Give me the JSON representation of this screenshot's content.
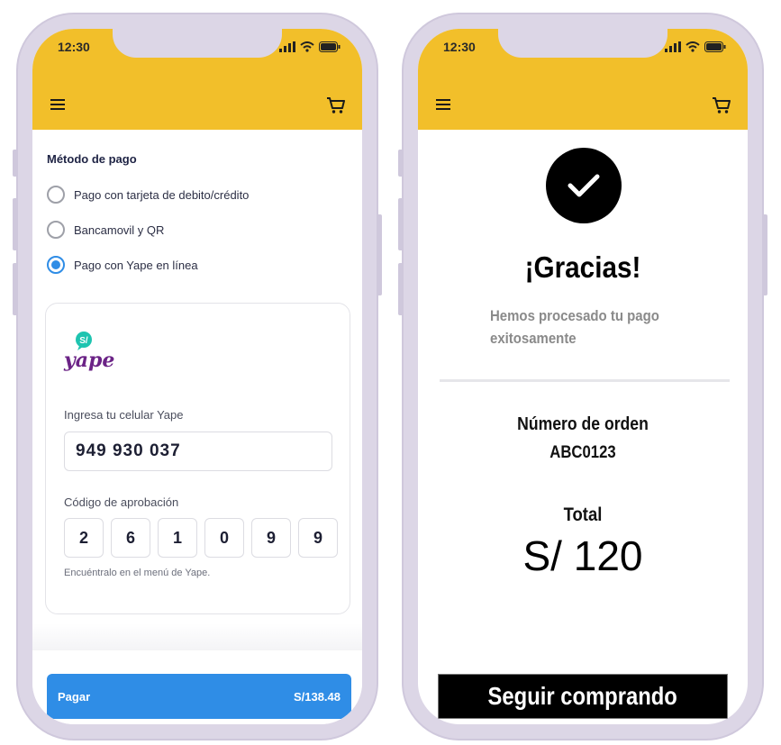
{
  "colors": {
    "header": "#f2bf2a",
    "accent_blue": "#2f8de6",
    "phone_frame": "#dcd6e6",
    "yape_purple": "#6b2386",
    "yape_teal": "#1ec4b0"
  },
  "status_bar": {
    "time": "12:30"
  },
  "left_screen": {
    "section_title": "Método de pago",
    "payment_options": [
      {
        "label": "Pago con tarjeta de debito/crédito",
        "selected": false
      },
      {
        "label": "Bancamovil y QR",
        "selected": false
      },
      {
        "label": "Pago con Yape en línea",
        "selected": true
      }
    ],
    "yape": {
      "logo_text": "yape",
      "logo_badge": "S/",
      "phone_label": "Ingresa tu celular Yape",
      "phone_value": "949 930 037",
      "code_label": "Código de aprobación",
      "code_digits": [
        "2",
        "6",
        "1",
        "0",
        "9",
        "9"
      ],
      "hint": "Encuéntralo en el menú de Yape."
    },
    "pay_button": {
      "label": "Pagar",
      "amount": "S/138.48"
    }
  },
  "right_screen": {
    "title": "¡Gracias!",
    "message": "Hemos procesado tu pago exitosamente",
    "order_label": "Número de orden",
    "order_value": "ABC0123",
    "total_label": "Total",
    "total_value": "S/ 120",
    "continue_button": "Seguir comprando"
  }
}
